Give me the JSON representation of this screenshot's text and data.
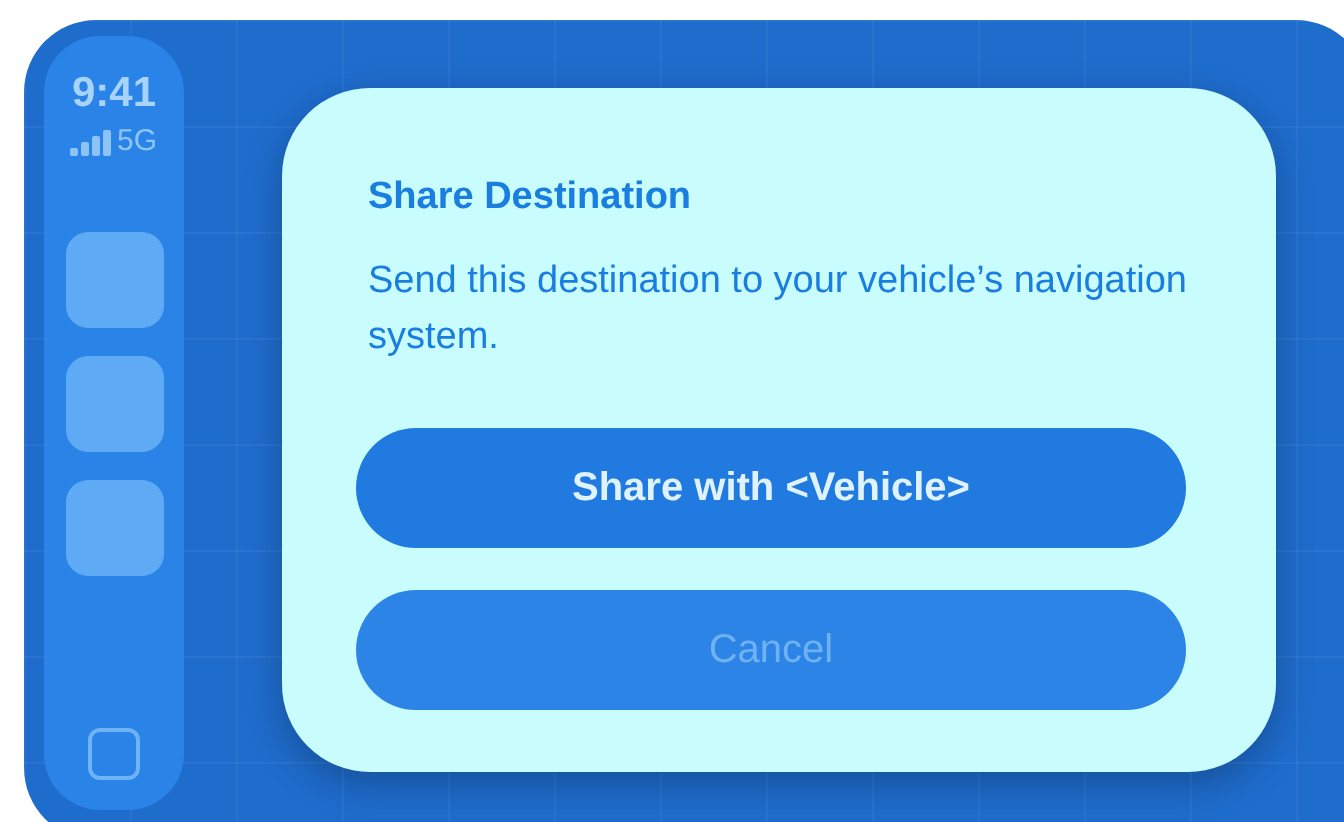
{
  "status": {
    "time": "9:41",
    "network": "5G"
  },
  "sidebar": {
    "apps": [
      {
        "kind": "tile"
      },
      {
        "kind": "tile"
      },
      {
        "kind": "tile"
      }
    ]
  },
  "dialog": {
    "title": "Share Destination",
    "message": "Send this destination to your vehicle’s navigation system.",
    "buttons": [
      {
        "label": "Share with <Vehicle>",
        "disabled": false
      },
      {
        "label": "Cancel",
        "disabled": true
      }
    ]
  }
}
